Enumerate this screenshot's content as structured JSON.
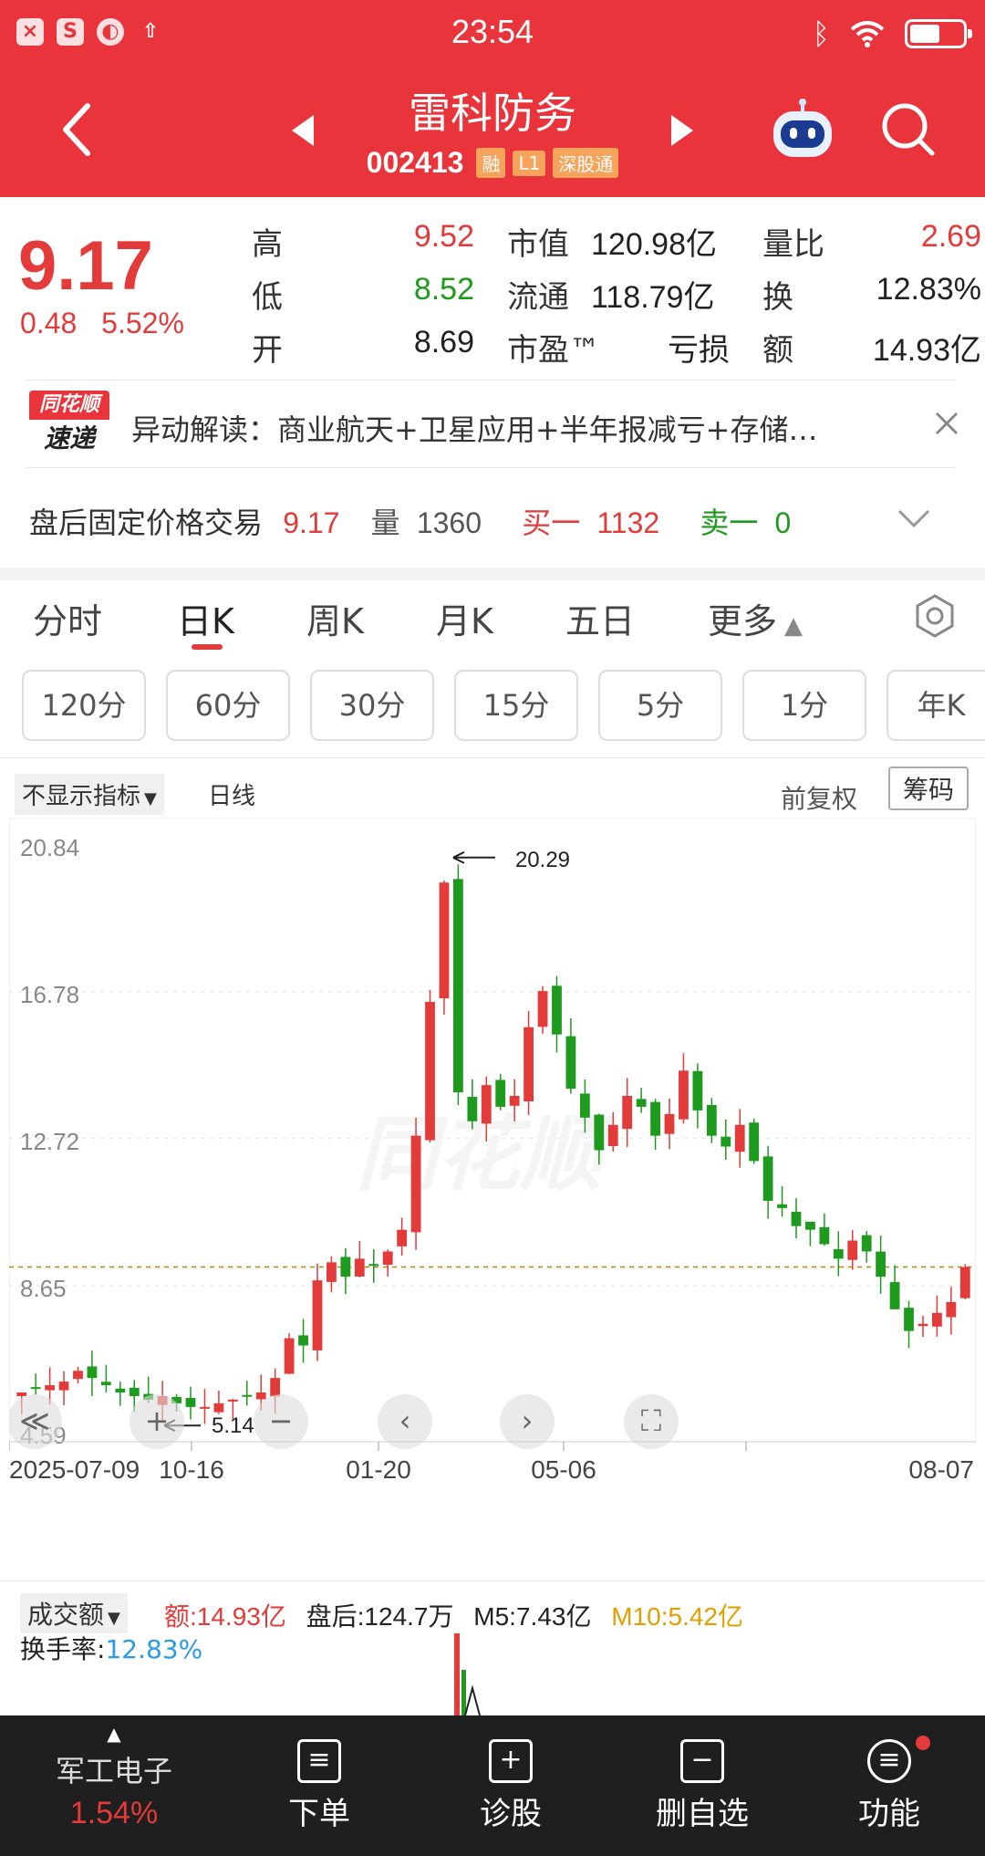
{
  "status_bar": {
    "time": "23:54"
  },
  "header": {
    "title": "雷科防务",
    "code": "002413",
    "tags": [
      "融",
      "L1",
      "深股通"
    ]
  },
  "quote": {
    "price": "9.17",
    "change": "0.48",
    "change_pct": "5.52%",
    "fields": [
      {
        "label": "高",
        "value": "9.52",
        "color": "red"
      },
      {
        "label": "低",
        "value": "8.52",
        "color": "green"
      },
      {
        "label": "开",
        "value": "8.69",
        "color": "black"
      },
      {
        "label": "市值",
        "value": "120.98亿"
      },
      {
        "label": "流通",
        "value": "118.79亿"
      },
      {
        "label": "市盈™",
        "value": "亏损"
      },
      {
        "label": "量比",
        "value": "2.69",
        "color": "red"
      },
      {
        "label": "换",
        "value": "12.83%"
      },
      {
        "label": "额",
        "value": "14.93亿"
      }
    ]
  },
  "news": {
    "badge_top": "同花顺",
    "badge_bottom": "速递",
    "text": "异动解读：商业航天+卫星应用+半年报减亏+存储…"
  },
  "after_hours": {
    "label": "盘后固定价格交易",
    "price": "9.17",
    "vol_label": "量",
    "vol": "1360",
    "buy_label": "买一",
    "buy": "1132",
    "sell_label": "卖一",
    "sell": "0"
  },
  "tabs": [
    "分时",
    "日K",
    "周K",
    "月K",
    "五日",
    "更多"
  ],
  "periods": [
    "120分",
    "60分",
    "30分",
    "15分",
    "5分",
    "1分",
    "年K"
  ],
  "chart_header": {
    "indicator": "不显示指标",
    "line_type": "日线",
    "adjust": "前复权",
    "chips": "筹码"
  },
  "chart_data": {
    "type": "candlestick",
    "y_ticks": [
      "20.84",
      "16.78",
      "12.72",
      "8.65",
      "4.59"
    ],
    "x_ticks": [
      "2025-07-09",
      "10-16",
      "01-20",
      "05-06",
      "08-07"
    ],
    "max_label": "20.29",
    "min_label": "5.14",
    "ylim": [
      4.59,
      20.84
    ],
    "current_price": 9.17,
    "series": [
      {
        "name": "close",
        "values": [
          5.7,
          5.8,
          5.9,
          6.0,
          6.3,
          6.1,
          5.9,
          5.7,
          5.6,
          5.5,
          5.6,
          5.4,
          5.3,
          5.3,
          5.4,
          5.5,
          5.6,
          5.7,
          6.1,
          7.2,
          7.0,
          8.8,
          9.3,
          8.9,
          9.4,
          9.2,
          9.6,
          10.2,
          12.8,
          16.5,
          19.8,
          14.0,
          13.2,
          14.2,
          13.6,
          13.9,
          15.8,
          16.8,
          15.6,
          14.1,
          13.3,
          12.4,
          13.1,
          13.9,
          13.6,
          12.8,
          13.4,
          14.6,
          13.5,
          12.8,
          12.5,
          13.1,
          12.1,
          11.0,
          10.8,
          10.3,
          10.2,
          9.8,
          9.4,
          9.9,
          9.6,
          8.9,
          8.0,
          7.4,
          7.6,
          7.9,
          8.2,
          9.17
        ]
      }
    ]
  },
  "volume_panel": {
    "selector": "成交额",
    "amount_label": "额:",
    "amount": "14.93亿",
    "after_label": "盘后:",
    "after": "124.7万",
    "m5_label": "M5:",
    "m5": "7.43亿",
    "m10_label": "M10:",
    "m10": "5.42亿",
    "turnover_label": "换手率:",
    "turnover": "12.83%"
  },
  "bottom_nav": {
    "sector_name": "军工电子",
    "sector_pct": "1.54%",
    "items": [
      "下单",
      "诊股",
      "删自选",
      "功能"
    ]
  },
  "colors": {
    "brand": "#e8343a",
    "up": "#e33a3a",
    "down": "#1e9a1e",
    "m10": "#e0a100",
    "turnover": "#2a9be8"
  }
}
